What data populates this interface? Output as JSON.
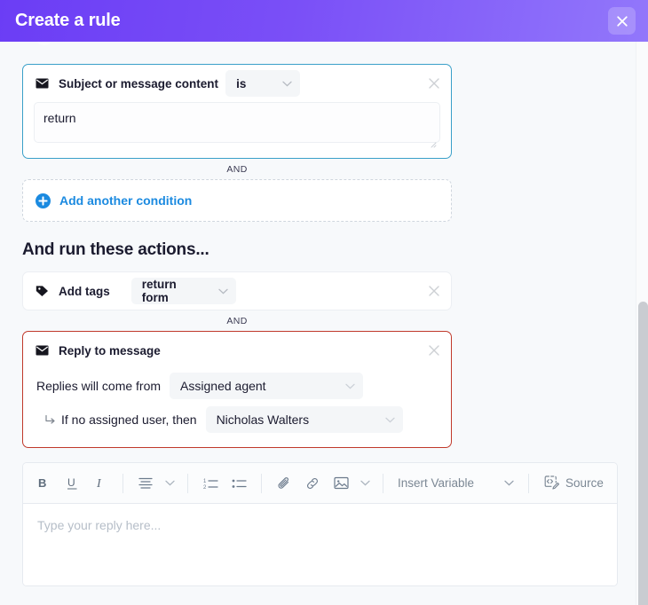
{
  "header": {
    "title": "Create a rule",
    "close_label": "Close",
    "close_icon": "close-icon",
    "gradient_from": "#6b3df5",
    "gradient_to": "#9277fb"
  },
  "conditions": {
    "card": {
      "icon": "envelope-icon",
      "label": "Subject or message content",
      "operator": "is",
      "operator_caret": "chevron-down-icon",
      "remove_icon": "close-icon",
      "value": "return",
      "border_color": "#3aa0c9"
    },
    "and_label": "AND",
    "add_another": {
      "icon": "plus-circle-icon",
      "label": "Add another condition",
      "color": "#1b8ae0"
    }
  },
  "actions": {
    "heading": "And run these actions...",
    "and_label": "AND",
    "add_tags": {
      "icon": "tag-icon",
      "label": "Add tags",
      "value": "return form",
      "caret": "chevron-down-icon",
      "remove_icon": "close-icon"
    },
    "reply": {
      "icon": "envelope-icon",
      "label": "Reply to message",
      "remove_icon": "close-icon",
      "border_color": "#c0392b",
      "from_label": "Replies will come from",
      "from_value": "Assigned agent",
      "fallback_arrow": "corner-down-right-icon",
      "fallback_label": "If no assigned user, then",
      "fallback_value": "Nicholas Walters"
    }
  },
  "editor": {
    "toolbar": [
      {
        "name": "bold-button",
        "glyph": "B",
        "title": "Bold"
      },
      {
        "name": "underline-button",
        "glyph": "U",
        "title": "Underline"
      },
      {
        "name": "italic-button",
        "glyph": "I",
        "title": "Italic"
      },
      {
        "name": "align-button",
        "glyph": "align-left-icon",
        "title": "Align"
      },
      {
        "name": "align-caret",
        "glyph": "chevron-down-icon",
        "title": "Align options"
      },
      {
        "name": "numbered-list-button",
        "glyph": "ordered-list-icon",
        "title": "Numbered list"
      },
      {
        "name": "bullet-list-button",
        "glyph": "unordered-list-icon",
        "title": "Bulleted list"
      },
      {
        "name": "attach-button",
        "glyph": "paperclip-icon",
        "title": "Attach file"
      },
      {
        "name": "link-button",
        "glyph": "link-icon",
        "title": "Insert link"
      },
      {
        "name": "image-button",
        "glyph": "image-icon",
        "title": "Insert image"
      },
      {
        "name": "image-caret",
        "glyph": "chevron-down-icon",
        "title": "Image options"
      }
    ],
    "insert_variable_label": "Insert Variable",
    "insert_variable_caret": "chevron-down-icon",
    "source_label": "Source",
    "source_icon": "code-edit-icon",
    "placeholder": "Type your reply here..."
  },
  "scrollbar": {
    "name": "vertical-scrollbar",
    "thumb_color": "#c9ccd1"
  }
}
